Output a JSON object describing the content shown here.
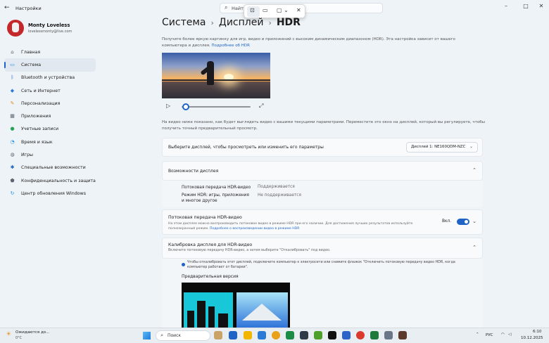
{
  "window": {
    "title": "Настройки",
    "back_icon": "back-arrow-icon"
  },
  "window_controls": {
    "minimize": "–",
    "maximize": "□",
    "close": "✕"
  },
  "top_search": {
    "text": "Найти"
  },
  "snipping_toolbar": {
    "camera": "⊡",
    "video": "▭",
    "mode": "▢ ⌄",
    "close": "✕"
  },
  "profile": {
    "name": "Monty Loveless",
    "email": "lovelessmonty@live.com"
  },
  "sidebar": {
    "items": [
      {
        "label": "Главная",
        "icon": "home-icon",
        "color": "#5a6470"
      },
      {
        "label": "Система",
        "icon": "system-icon",
        "color": "#1f8de0",
        "active": true
      },
      {
        "label": "Bluetooth и устройства",
        "icon": "bluetooth-icon",
        "color": "#1f63c6"
      },
      {
        "label": "Сеть и Интернет",
        "icon": "wifi-icon",
        "color": "#2a7ad6"
      },
      {
        "label": "Персонализация",
        "icon": "brush-icon",
        "color": "#e08b2d"
      },
      {
        "label": "Приложения",
        "icon": "apps-icon",
        "color": "#5a6470"
      },
      {
        "label": "Учетные записи",
        "icon": "person-icon",
        "color": "#2aa35a"
      },
      {
        "label": "Время и язык",
        "icon": "globe-clock-icon",
        "color": "#1f8de0"
      },
      {
        "label": "Игры",
        "icon": "gamepad-icon",
        "color": "#5a6470"
      },
      {
        "label": "Специальные возможности",
        "icon": "accessibility-icon",
        "color": "#1f63c6"
      },
      {
        "label": "Конфиденциальность и защита",
        "icon": "shield-icon",
        "color": "#5a6470"
      },
      {
        "label": "Центр обновления Windows",
        "icon": "update-icon",
        "color": "#1f8de0"
      }
    ]
  },
  "breadcrumb": {
    "a": "Система",
    "b": "Дисплей",
    "c": "HDR",
    "sep": "›"
  },
  "intro": {
    "text": "Получите более яркую картинку для игр, видео и приложений с высоким динамическим диапазоном (HDR). Эта настройка зависит от вашего компьютера и дисплея.",
    "link": "Подробнее об HDR"
  },
  "player": {
    "play": "▷",
    "expand": "⤢",
    "progress": 0.02
  },
  "preview_text": "На видео ниже показано, как будет выглядеть видео с вашими текущими параметрами. Переместите это окно на дисплей, который вы регулируете, чтобы получить точный предварительный просмотр.",
  "display_select": {
    "label": "Выберите дисплей, чтобы просмотреть или изменить его параметры",
    "value": "Дисплей 1: NE160QDM-NZC"
  },
  "capabilities": {
    "title": "Возможности дисплея",
    "rows": [
      {
        "k": "Потоковая передача HDR-видео",
        "v": "Поддерживается"
      },
      {
        "k": "Режим HDR: игры, приложения и многое другое",
        "v": "Не поддерживается"
      }
    ]
  },
  "hdr_stream": {
    "title": "Потоковая передача HDR-видео",
    "desc": "На этом дисплее можно воспроизводить потоковое видео в режиме HDR при его наличии. Для достижения лучших результатов используйте полноэкранный режим.",
    "link": "Подробнее о воспроизведении видео в режиме HDR",
    "toggle_label": "Вкл.",
    "enabled": true
  },
  "calibration": {
    "title": "Калибровка дисплея для HDR-видео",
    "desc": "Включите потоковую передачу HDR-видео, а затем выберите \"Откалибровать\" под видео.",
    "info": "Чтобы откалибровать этот дисплей, подключите компьютер к электросети или снимите флажок \"Отключить потоковую передачу видео HDR, когда компьютер работает от батареи\".",
    "preview_label": "Предварительная версия"
  },
  "taskbar": {
    "weather_title": "Ожидаются до...",
    "weather_temp": "0°C",
    "search": "Поиск",
    "lang": "РУС",
    "time": "6:10",
    "date": "10.12.2025"
  }
}
